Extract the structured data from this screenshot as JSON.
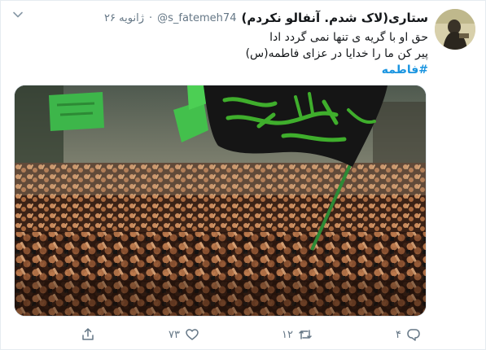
{
  "tweet": {
    "author_name": "ستاری(لاک شدم. آنفالو نکردم)",
    "author_handle": "@s_fatemeh74",
    "separator": "·",
    "date": "۲۶ ژانویه",
    "text_lines": [
      "حق او با گریه ی تنها نمی گردد ادا",
      "پیر کن ما را خدایا در عزای فاطمه(س)"
    ],
    "hashtag": "#فاطمه",
    "image_alt": "",
    "flag_text": "یا فاطمه الزهرا",
    "actions": {
      "reply_count": "۴",
      "retweet_count": "۱۲",
      "like_count": "۷۳",
      "share_count": ""
    }
  },
  "colors": {
    "link": "#1b95e0",
    "secondary_text": "#657786",
    "primary_text": "#14171a",
    "border": "#e6ecf0",
    "flag_black": "#151515",
    "flag_green_text": "#3fae2c",
    "banner_green": "#3db64a"
  },
  "icons": [
    "chevron-down-icon",
    "share-icon",
    "like-icon",
    "retweet-icon",
    "reply-icon"
  ]
}
